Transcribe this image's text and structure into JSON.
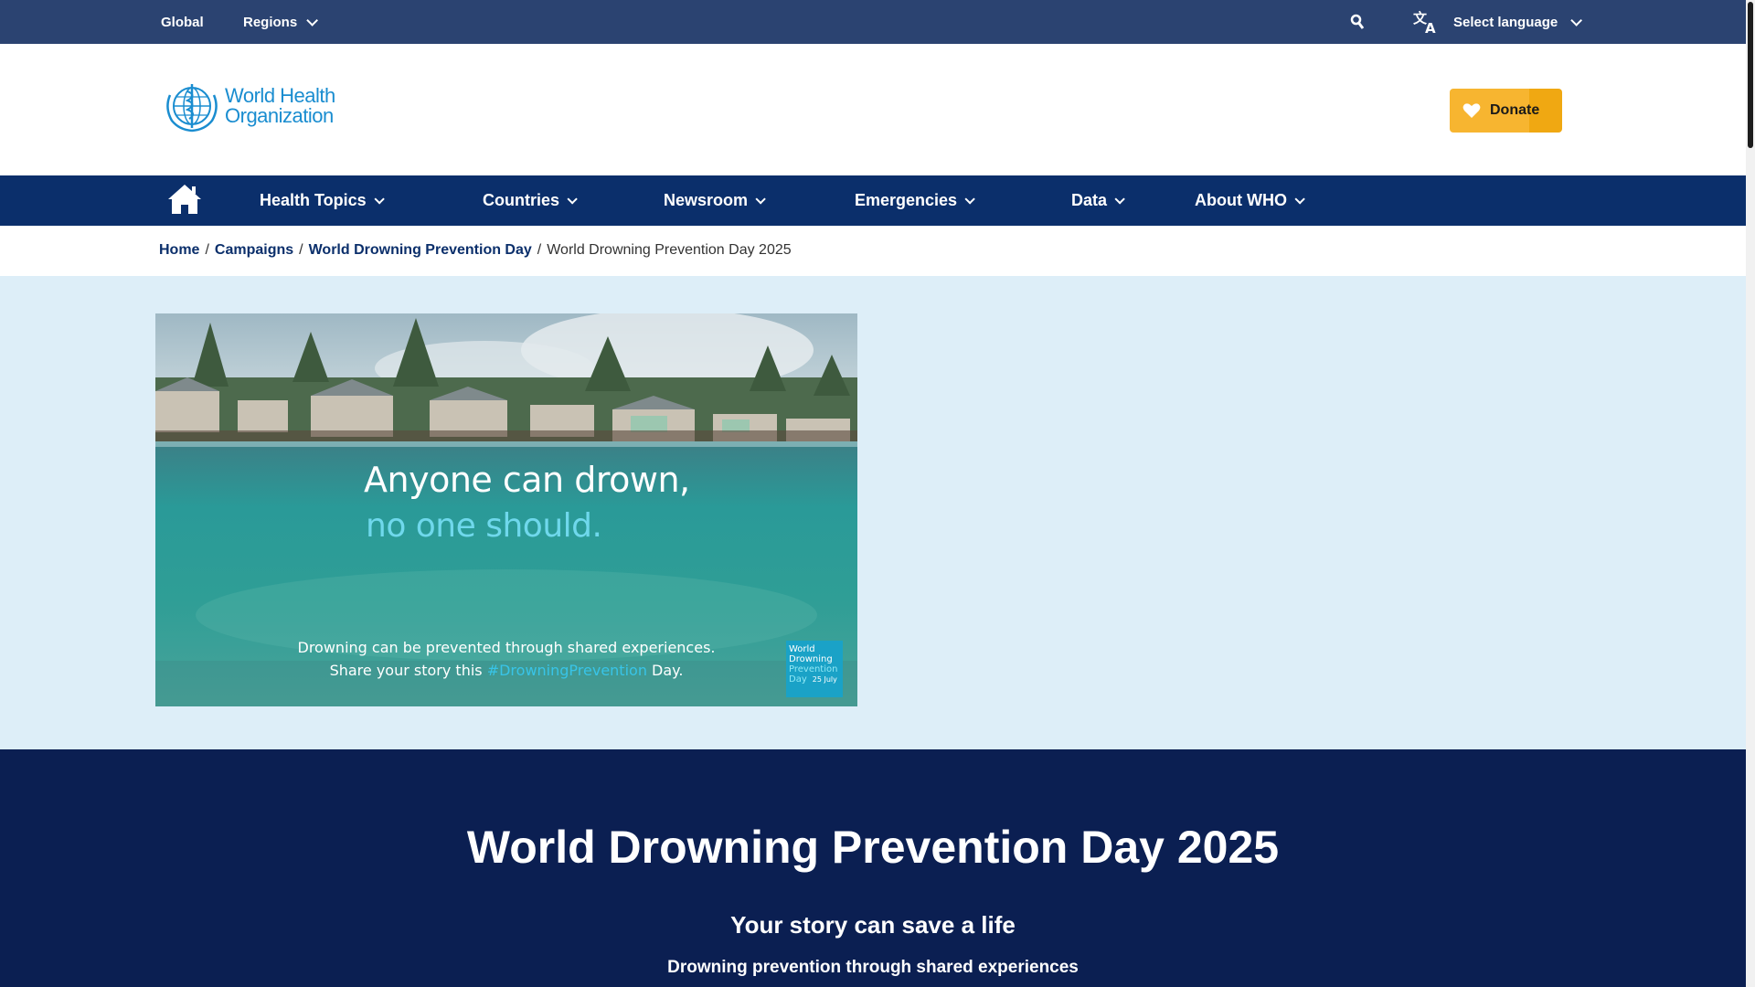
{
  "topbar": {
    "global_label": "Global",
    "regions_label": "Regions",
    "search_icon": "search-icon",
    "language_icon": "translate-icon",
    "language_label": "Select language"
  },
  "header": {
    "logo_line1": "World Health",
    "logo_line2": "Organization",
    "donate_label": "Donate"
  },
  "nav": {
    "home_icon": "home-icon",
    "items": [
      {
        "label": "Health Topics"
      },
      {
        "label": "Countries"
      },
      {
        "label": "Newsroom"
      },
      {
        "label": "Emergencies"
      },
      {
        "label": "Data"
      },
      {
        "label": "About WHO"
      }
    ]
  },
  "breadcrumb": {
    "items": [
      "Home",
      "Campaigns",
      "World Drowning Prevention Day"
    ],
    "current": "World Drowning Prevention Day 2025"
  },
  "hero": {
    "headline1": "Anyone can drown,",
    "headline2": "no one should.",
    "sub_line1": "Drowning can be prevented through shared experiences.",
    "sub_line2_pre": "Share your story this ",
    "sub_hashtag": "#DrowningPrevention",
    "sub_line2_post": " Day.",
    "badge_line1": "World",
    "badge_line2": "Drowning",
    "badge_line3": "Prevention",
    "badge_line4": "Day",
    "badge_date": "25 July"
  },
  "banner": {
    "title": "World Drowning Prevention Day 2025",
    "subtitle": "Your story can save a life",
    "tagline": "Drowning prevention through shared experiences"
  },
  "colors": {
    "topbar_bg": "#2b4371",
    "nav_bg": "#0b2f6b",
    "banner_bg": "#0b1f52",
    "hero_bg": "#ddeef8",
    "donate_bg": "#f7b530",
    "link": "#0b2f6b"
  }
}
